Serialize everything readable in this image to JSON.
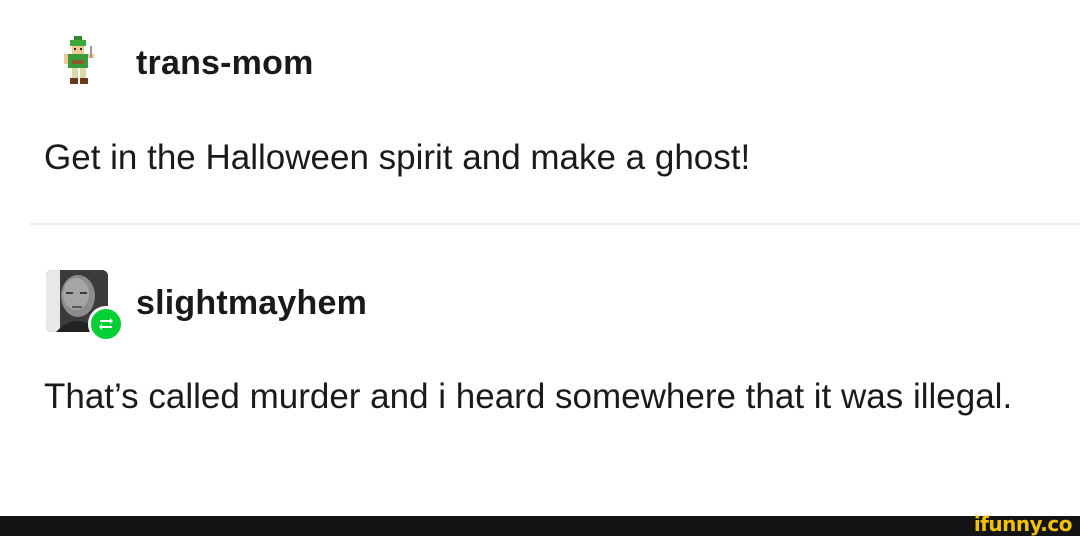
{
  "posts": [
    {
      "username": "trans-mom",
      "avatar_icon": "pixel-elf-sprite-icon",
      "text": "Get in the Halloween spirit and make a ghost!"
    },
    {
      "username": "slightmayhem",
      "avatar_icon": "user-photo-avatar",
      "badge_icon": "reblog-icon",
      "badge_color": "#00cf35",
      "text": "That’s called murder and i heard somewhere that it was illegal."
    }
  ],
  "watermark": {
    "logo_text": "ifunny.co"
  },
  "colors": {
    "background": "#ffffff",
    "text": "#1a1a1a",
    "footer": "#141414",
    "watermark": "#f2c200"
  }
}
